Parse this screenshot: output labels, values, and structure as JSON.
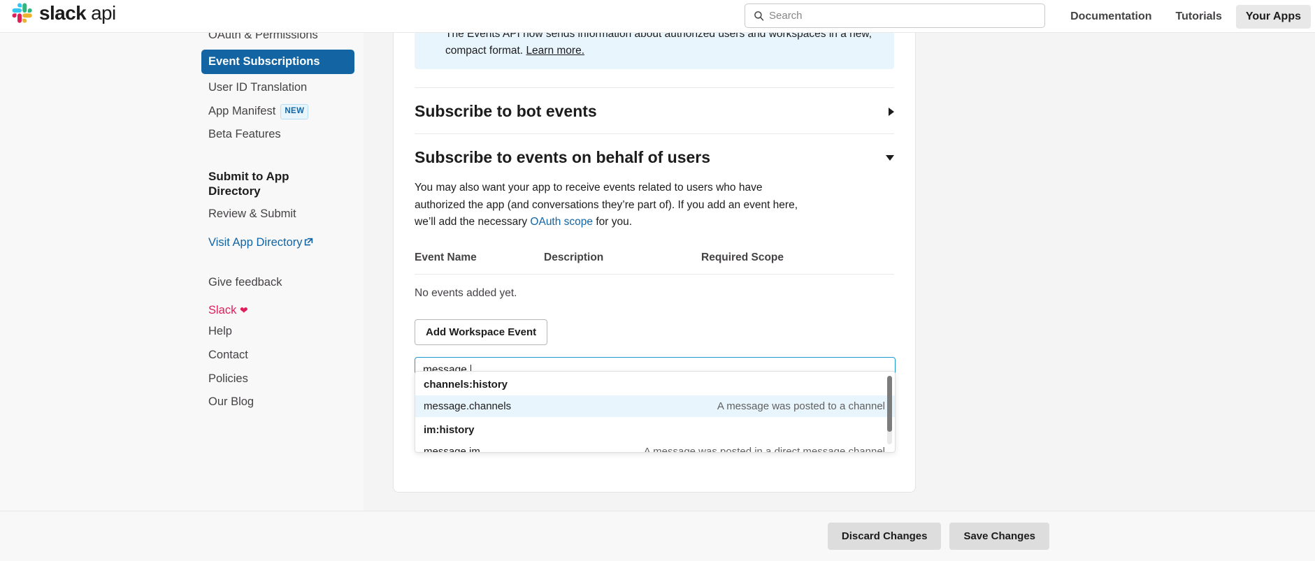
{
  "topbar": {
    "brand_bold": "slack",
    "brand_light": "api",
    "search_placeholder": "Search",
    "search_value": "",
    "nav": [
      {
        "label": "Documentation",
        "active": false
      },
      {
        "label": "Tutorials",
        "active": false
      },
      {
        "label": "Your Apps",
        "active": true
      }
    ]
  },
  "sidebar": {
    "items": [
      {
        "label": "OAuth & Permissions",
        "state": "cut"
      },
      {
        "label": "Event Subscriptions",
        "state": "active"
      },
      {
        "label": "User ID Translation",
        "state": "normal"
      },
      {
        "label": "App Manifest",
        "state": "normal",
        "badge": "NEW"
      },
      {
        "label": "Beta Features",
        "state": "normal"
      }
    ],
    "section_heading": "Submit to App Directory",
    "review_label": "Review & Submit",
    "visit_directory_label": "Visit App Directory",
    "feedback_label": "Give feedback",
    "footer_links": [
      {
        "label": "Slack",
        "heart": true
      },
      {
        "label": "Help",
        "heart": false
      },
      {
        "label": "Contact",
        "heart": false
      },
      {
        "label": "Policies",
        "heart": false
      },
      {
        "label": "Our Blog",
        "heart": false
      }
    ]
  },
  "main": {
    "notice": {
      "text": "The Events API now sends information about authorized users and workspaces in a new, compact format.",
      "link_label": "Learn more."
    },
    "bot_section": {
      "title": "Subscribe to bot events",
      "expanded": false
    },
    "user_section": {
      "title": "Subscribe to events on behalf of users",
      "expanded": true,
      "description_part1": "You may also want your app to receive events related to users who have authorized the app (and conversations they’re part of). If you add an event here, we’ll add the necessary ",
      "description_link": "OAuth scope",
      "description_part2": " for you.",
      "table_headers": [
        "Event Name",
        "Description",
        "Required Scope"
      ],
      "empty_message": "No events added yet.",
      "add_button_label": "Add Workspace Event",
      "input_value": "message."
    },
    "dropdown": {
      "entries": [
        {
          "kind": "group",
          "label": "channels:history"
        },
        {
          "kind": "item",
          "label": "message.channels",
          "description": "A message was posted to a channel",
          "selected": true
        },
        {
          "kind": "group",
          "label": "im:history"
        },
        {
          "kind": "item",
          "label": "message.im",
          "description": "A message was posted in a direct message channel",
          "selected": false
        }
      ]
    }
  },
  "bottombar": {
    "discard_label": "Discard Changes",
    "save_label": "Save Changes"
  },
  "colors": {
    "accent_blue": "#1264a3",
    "link_blue": "#1d9bd1",
    "slack_pink": "#e01e5a",
    "notice_bg": "#e8f5fc",
    "page_bg": "#f4f4f4"
  }
}
